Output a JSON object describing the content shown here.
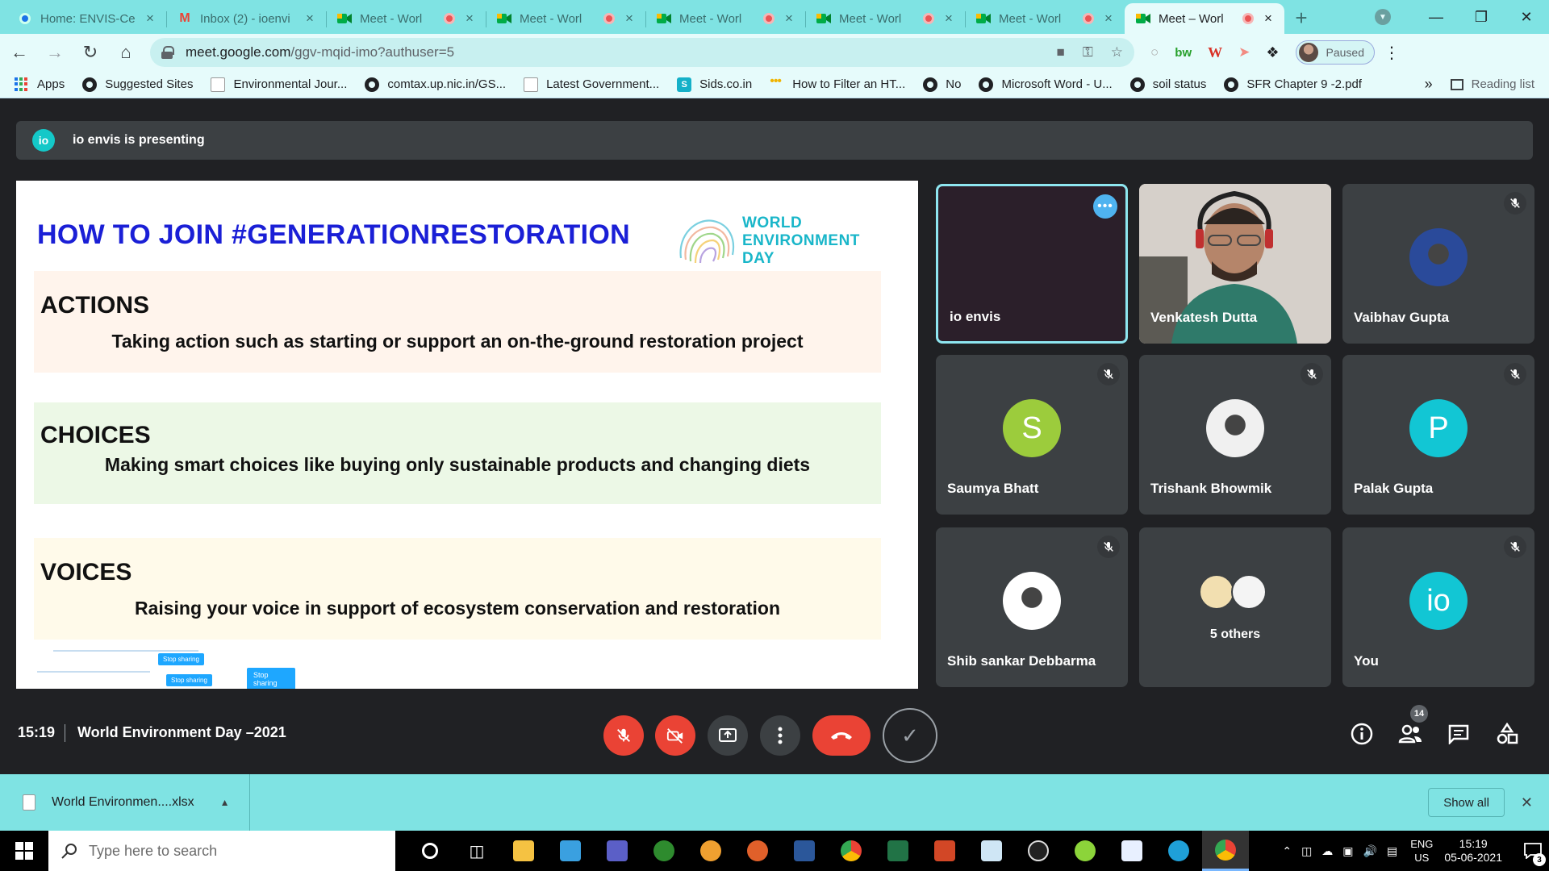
{
  "browser": {
    "tabs": [
      {
        "title": "Home: ENVIS-Ce",
        "favicon": "envis-favicon"
      },
      {
        "title": "Inbox (2) - ioenvi",
        "favicon": "gmail-icon"
      },
      {
        "title": "Meet - Worl",
        "favicon": "meet-icon",
        "recording": true
      },
      {
        "title": "Meet - Worl",
        "favicon": "meet-icon",
        "recording": true
      },
      {
        "title": "Meet - Worl",
        "favicon": "meet-icon",
        "recording": true
      },
      {
        "title": "Meet - Worl",
        "favicon": "meet-icon",
        "recording": true
      },
      {
        "title": "Meet - Worl",
        "favicon": "meet-icon",
        "recording": true
      },
      {
        "title": "Meet – Worl",
        "favicon": "meet-icon",
        "recording": true,
        "active": true
      }
    ],
    "url_host": "meet.google.com",
    "url_path": "/ggv-mqid-imo?authuser=5",
    "profile_status": "Paused",
    "bookmarks": [
      {
        "label": "Apps",
        "icon": "apps-icon"
      },
      {
        "label": "Suggested Sites",
        "icon": "globe-icon"
      },
      {
        "label": "Environmental Jour...",
        "icon": "doc-icon"
      },
      {
        "label": "comtax.up.nic.in/GS...",
        "icon": "globe-icon"
      },
      {
        "label": "Latest Government...",
        "icon": "doc-icon"
      },
      {
        "label": "Sids.co.in",
        "icon": "sids-icon"
      },
      {
        "label": "How to Filter an HT...",
        "icon": "dots-icon"
      },
      {
        "label": "No",
        "icon": "globe-icon"
      },
      {
        "label": "Microsoft Word - U...",
        "icon": "globe-icon"
      },
      {
        "label": "soil status",
        "icon": "globe-icon"
      },
      {
        "label": "SFR Chapter 9 -2.pdf",
        "icon": "globe-icon"
      }
    ],
    "bookmarks_more": "»",
    "reading_list": "Reading list"
  },
  "meet": {
    "presenting_badge": "io",
    "presenting_text": "io envis is presenting",
    "slide": {
      "title": "HOW TO JOIN #GENERATIONRESTORATION",
      "logo_lines": [
        "WORLD",
        "ENVIRONMENT",
        "DAY"
      ],
      "sections": [
        {
          "heading": "ACTIONS",
          "body": "Taking action such as starting or support an on-the-ground restoration project"
        },
        {
          "heading": "CHOICES",
          "body": "Making smart choices like buying only sustainable products and changing diets"
        },
        {
          "heading": "VOICES",
          "body": "Raising your voice in support of ecosystem conservation and restoration"
        }
      ],
      "stop_sharing_label": "Stop sharing"
    },
    "participants": [
      {
        "name": "io envis",
        "type": "presenter"
      },
      {
        "name": "Venkatesh Dutta",
        "type": "video"
      },
      {
        "name": "Vaibhav Gupta",
        "type": "photo",
        "color": "#2a4a9a",
        "muted": true
      },
      {
        "name": "Saumya Bhatt",
        "type": "initial",
        "initial": "S",
        "color": "#9ccc3c",
        "muted": true
      },
      {
        "name": "Trishank Bhowmik",
        "type": "photo",
        "color": "#f0f0f0",
        "muted": true
      },
      {
        "name": "Palak Gupta",
        "type": "initial",
        "initial": "P",
        "color": "#12c6d4",
        "muted": true
      },
      {
        "name": "Shib sankar Debbarma",
        "type": "photo",
        "color": "#ffffff",
        "muted": true
      },
      {
        "name": "5 others",
        "type": "others"
      },
      {
        "name": "You",
        "type": "initial",
        "initial": "io",
        "color": "#12c6d4",
        "muted": true
      }
    ],
    "time": "15:19",
    "meeting_title": "World Environment Day –2021",
    "people_count": "14",
    "colors": {
      "danger": "#ea4335",
      "tile": "#3c4043",
      "accent": "#12c6d4"
    }
  },
  "downloads": {
    "file": "World Environmen....xlsx",
    "show_all": "Show all"
  },
  "taskbar": {
    "search_placeholder": "Type here to search",
    "lang_line1": "ENG",
    "lang_line2": "US",
    "time": "15:19",
    "date": "05-06-2021",
    "notif_count": "3"
  }
}
